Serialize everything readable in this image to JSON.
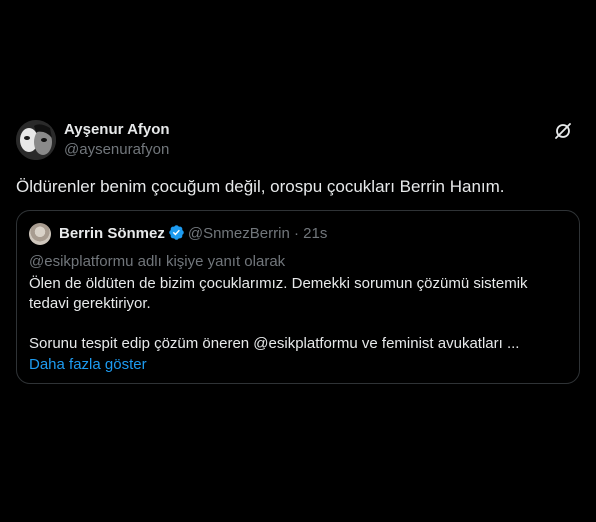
{
  "tweet": {
    "author_name": "Ayşenur Afyon",
    "author_handle": "@aysenurafyon",
    "text": "Öldürenler benim çocuğum değil, orospu çocukları Berrin Hanım.",
    "menu_icon": "grok-icon"
  },
  "quote": {
    "author_name": "Berrin Sönmez",
    "author_handle": "@SnmezBerrin",
    "separator": "·",
    "time": "21s",
    "verified_icon": "verified-badge-icon",
    "reply_context": "@esikplatformu adlı kişiye yanıt olarak",
    "paragraph1": "Ölen de öldüten de bizim çocuklarımız. Demekki sorumun çözümü sistemik tedavi gerektiriyor.",
    "paragraph2": "Sorunu tespit edip çözüm öneren @esikplatformu ve feminist avukatları ...",
    "show_more": "Daha fazla göster"
  },
  "colors": {
    "background": "#000000",
    "text": "#e7e9ea",
    "secondary": "#71767b",
    "accent": "#1d9bf0",
    "border": "#2f3336"
  }
}
